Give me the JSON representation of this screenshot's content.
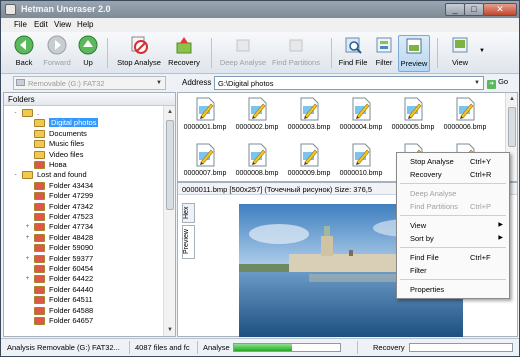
{
  "window": {
    "title": "Hetman Uneraser 2.0"
  },
  "menu": [
    "File",
    "Edit",
    "View",
    "Help"
  ],
  "toolbar": {
    "back": "Back",
    "forward": "Forward",
    "up": "Up",
    "stop_analyse": "Stop Analyse",
    "recovery": "Recovery",
    "deep_analyse": "Deep Analyse",
    "find_partitions": "Find Partitions",
    "find_file": "Find File",
    "filter": "Filter",
    "preview": "Preview",
    "view": "View"
  },
  "address": {
    "drive": "Removable (G:) FAT32",
    "label": "Address",
    "path": "G:\\Digital photos",
    "go": "Go"
  },
  "folders": {
    "header": "Folders",
    "items": [
      {
        "label": ".",
        "expander": "-",
        "color": "#f2c94c"
      },
      {
        "label": "Digital photos",
        "expander": "",
        "color": "#f2c94c",
        "selected": true
      },
      {
        "label": "Documents",
        "expander": "",
        "color": "#f2c94c"
      },
      {
        "label": "Music files",
        "expander": "",
        "color": "#f2c94c"
      },
      {
        "label": "Video files",
        "expander": "",
        "color": "#f2c94c"
      },
      {
        "label": "Нова",
        "expander": "",
        "color": "#e0564b"
      },
      {
        "label": "Lost and found",
        "expander": "-",
        "color": "#f2c94c"
      },
      {
        "label": "Folder 43434",
        "expander": "",
        "color": "#e0564b"
      },
      {
        "label": "Folder 47299",
        "expander": "",
        "color": "#e0564b"
      },
      {
        "label": "Folder 47342",
        "expander": "",
        "color": "#e0564b"
      },
      {
        "label": "Folder 47523",
        "expander": "",
        "color": "#e0564b"
      },
      {
        "label": "Folder 47734",
        "expander": "+",
        "color": "#e0564b"
      },
      {
        "label": "Folder 48428",
        "expander": "+",
        "color": "#e0564b"
      },
      {
        "label": "Folder 59090",
        "expander": "",
        "color": "#e0564b"
      },
      {
        "label": "Folder 59377",
        "expander": "+",
        "color": "#e0564b"
      },
      {
        "label": "Folder 60454",
        "expander": "",
        "color": "#e0564b"
      },
      {
        "label": "Folder 64422",
        "expander": "+",
        "color": "#e0564b"
      },
      {
        "label": "Folder 64440",
        "expander": "",
        "color": "#e0564b"
      },
      {
        "label": "Folder 64511",
        "expander": "",
        "color": "#e0564b"
      },
      {
        "label": "Folder 64588",
        "expander": "",
        "color": "#e0564b"
      },
      {
        "label": "Folder 64657",
        "expander": "",
        "color": "#e0564b"
      }
    ]
  },
  "files": [
    "0000001.bmp",
    "0000002.bmp",
    "0000003.bmp",
    "0000004.bmp",
    "0000005.bmp",
    "0000006.bmp",
    "0000007.bmp",
    "0000008.bmp",
    "0000009.bmp",
    "0000010.bmp",
    "",
    ""
  ],
  "preview": {
    "info": "0000011.bmp     [500x257]     (Точечный рисунок)     Size: 376,5",
    "tab_hex": "Hex",
    "tab_preview": "Preview"
  },
  "context_menu": [
    {
      "label": "Stop Analyse",
      "shortcut": "Ctrl+Y",
      "disabled": false
    },
    {
      "label": "Recovery",
      "shortcut": "Ctrl+R",
      "disabled": false
    },
    {
      "label": "Deep Analyse",
      "shortcut": "",
      "disabled": true
    },
    {
      "label": "Find Partitions",
      "shortcut": "Ctrl+P",
      "disabled": true
    },
    {
      "label": "View",
      "shortcut": "",
      "disabled": false,
      "submenu": true
    },
    {
      "label": "Sort by",
      "shortcut": "",
      "disabled": false,
      "submenu": true
    },
    {
      "label": "Find File",
      "shortcut": "Ctrl+F",
      "disabled": false
    },
    {
      "label": "Filter",
      "shortcut": "",
      "disabled": false
    },
    {
      "label": "Properties",
      "shortcut": "",
      "disabled": false
    }
  ],
  "status": {
    "analysis": "Analysis Removable (G:) FAT32...",
    "count": "4087 files and fc",
    "analyse_label": "Analyse",
    "analyse_progress": 0.55,
    "recovery_label": "Recovery",
    "recovery_progress": 0
  },
  "colors": {
    "accent": "#3399ff",
    "progress": "#22a822"
  },
  "icons": {
    "back": "back-arrow-icon",
    "forward": "forward-arrow-icon",
    "up": "up-arrow-icon",
    "stop": "stop-icon",
    "recovery": "recovery-icon",
    "find": "find-file-icon",
    "filter": "filter-icon",
    "preview": "preview-icon",
    "view": "view-icon",
    "file": "bmp-file-icon",
    "folder": "folder-icon"
  }
}
